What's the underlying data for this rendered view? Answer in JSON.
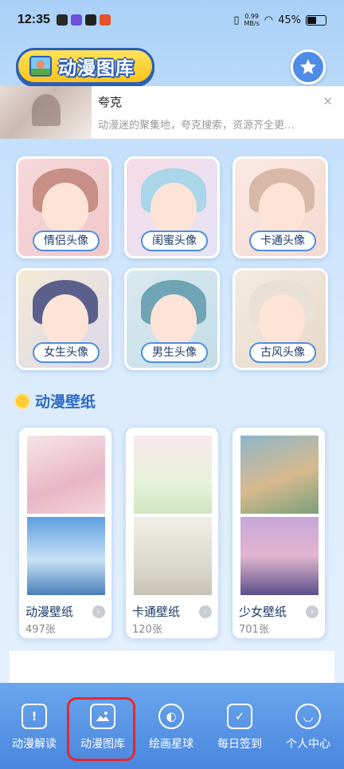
{
  "status": {
    "time": "12:35",
    "net_speed": "0.99",
    "net_unit": "MB/s",
    "battery": "45%"
  },
  "header": {
    "title": "动漫图库"
  },
  "ad": {
    "title": "夸克",
    "description": "动漫迷的聚集地，夸克搜索，资源齐全更…",
    "close": "✕"
  },
  "avatars": [
    {
      "label": "情侣头像"
    },
    {
      "label": "闺蜜头像"
    },
    {
      "label": "卡通头像"
    },
    {
      "label": "女生头像"
    },
    {
      "label": "男生头像"
    },
    {
      "label": "古风头像"
    }
  ],
  "wallpapers": {
    "section_title": "动漫壁纸",
    "items": [
      {
        "name": "动漫壁纸",
        "count": "497张"
      },
      {
        "name": "卡通壁纸",
        "count": "120张"
      },
      {
        "name": "少女壁纸",
        "count": "701张"
      }
    ]
  },
  "nav": [
    {
      "label": "动漫解读",
      "icon": "info-icon"
    },
    {
      "label": "动漫图库",
      "icon": "gallery-icon",
      "active": true
    },
    {
      "label": "绘画星球",
      "icon": "planet-icon"
    },
    {
      "label": "每日签到",
      "icon": "checkin-icon"
    },
    {
      "label": "个人中心",
      "icon": "profile-icon"
    }
  ],
  "colors": {
    "accent": "#4a86de",
    "title_yellow": "#ffc21a",
    "highlight": "#e5272e"
  }
}
